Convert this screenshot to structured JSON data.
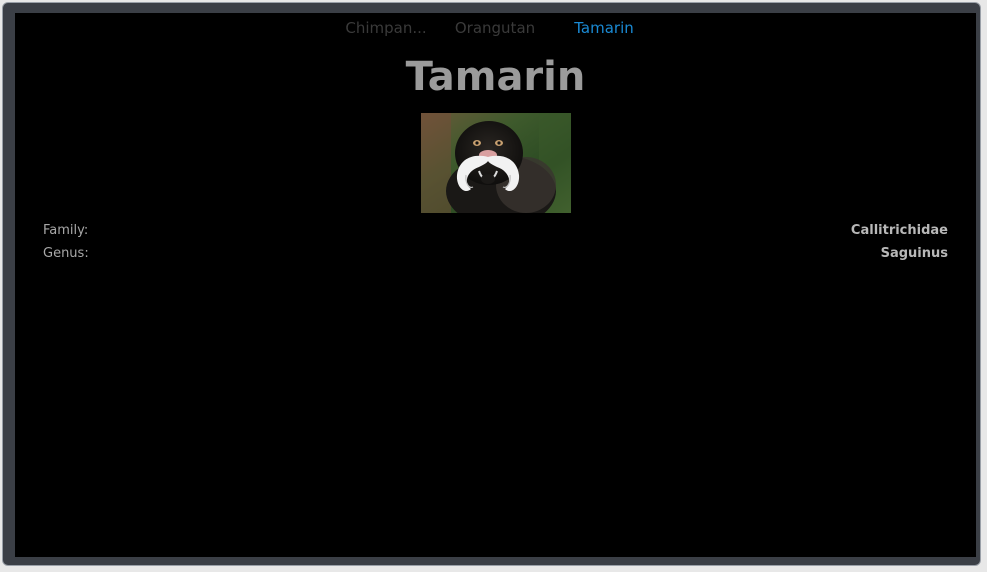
{
  "tabs": [
    {
      "label": "Chimpan...",
      "active": false
    },
    {
      "label": "Orangutan",
      "active": false
    },
    {
      "label": "Tamarin",
      "active": true
    }
  ],
  "page": {
    "title": "Tamarin"
  },
  "image": {
    "icon": "tamarin-photo"
  },
  "details": [
    {
      "label": "Family:",
      "value": "Callitrichidae"
    },
    {
      "label": "Genus:",
      "value": "Saguinus"
    }
  ],
  "colors": {
    "background": "#000000",
    "tab_active": "#1a8ad4",
    "tab_inactive": "#3a3a3a",
    "title": "#9b9b9b"
  }
}
